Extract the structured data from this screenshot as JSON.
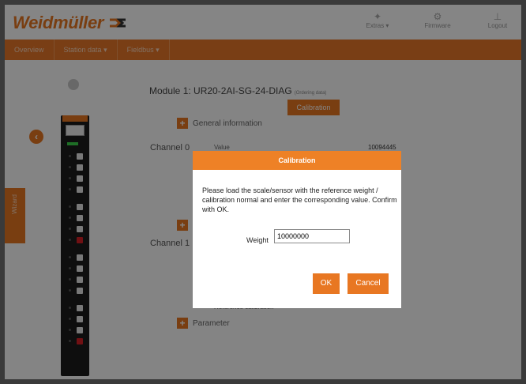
{
  "header": {
    "logo_text": "Weidmüller",
    "extras_label": "Extras",
    "firmware_label": "Firmware",
    "logout_label": "Logout"
  },
  "nav": {
    "items": [
      "Overview",
      "Station data",
      "Fieldbus"
    ]
  },
  "side_tab": {
    "label": "Wizard"
  },
  "module": {
    "title": "Module 1: UR20-2AI-SG-24-DIAG",
    "ordering_link": "(Ordering data)",
    "calibration_button": "Calibration",
    "general_information": "General information",
    "channel_0": "Channel 0",
    "channel_0_value_label": "Value",
    "channel_0_value": "10094445",
    "channel_1": "Channel 1",
    "channel_1_row_label": "Reference calibration",
    "parameter": "Parameter"
  },
  "dialog": {
    "title": "Calibration",
    "message": "Please load the scale/sensor with the reference weight / calibration normal and enter the corresponding value. Confirm with OK.",
    "weight_label": "Weight",
    "weight_value": "10000000",
    "ok_label": "OK",
    "cancel_label": "Cancel"
  },
  "colors": {
    "accent": "#e87722",
    "dialog_title_bg": "#ee8126",
    "terminal_red": "#d81f26",
    "led_green": "#3ad34a"
  }
}
